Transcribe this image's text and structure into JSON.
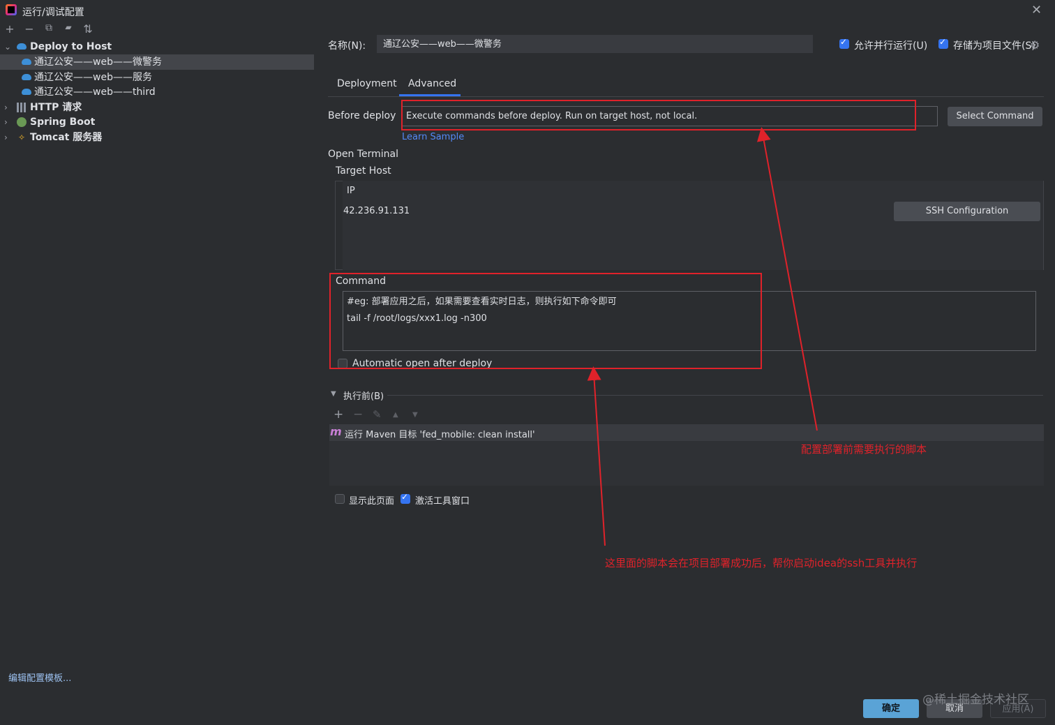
{
  "window": {
    "title": "运行/调试配置",
    "close": "✕"
  },
  "left_toolbar": {
    "add": "+",
    "remove": "−",
    "copy": "⧉",
    "folder": "▰",
    "sort": "⇅"
  },
  "tree": {
    "deploy_to_host": "Deploy to Host",
    "items": [
      "通辽公安——web——微警务",
      "通辽公安——web——服务",
      "通辽公安——web——third"
    ],
    "http": "HTTP 请求",
    "spring": "Spring Boot",
    "tomcat": "Tomcat 服务器"
  },
  "edit_templates": "编辑配置模板...",
  "help": "?",
  "name": {
    "label": "名称(N):",
    "value": "通辽公安——web——微警务"
  },
  "allow_parallel": "允许并行运行(U)",
  "store_project": "存储为项目文件(S)",
  "tabs": [
    "Deployment",
    "Advanced"
  ],
  "before_deploy": {
    "label": "Before deploy",
    "value": "Execute commands before deploy. Run on target host, not local.",
    "button": "Select Command",
    "link": "Learn Sample"
  },
  "open_terminal": "Open Terminal",
  "target_host": {
    "label": "Target Host",
    "ip_label": "IP",
    "ip": "42.236.91.131",
    "ssh_button": "SSH Configuration"
  },
  "command": {
    "label": "Command",
    "line1": "#eg: 部署应用之后，如果需要查看实时日志，则执行如下命令即可",
    "line2": "tail -f /root/logs/xxx1.log -n300",
    "auto_open": "Automatic open after deploy"
  },
  "before_launch": {
    "title": "执行前(B)",
    "toolbar": {
      "add": "+",
      "remove": "−",
      "edit": "✎",
      "up": "▲",
      "down": "▼"
    },
    "maven_icon": "m",
    "task": "运行 Maven 目标 'fed_mobile: clean install'"
  },
  "show_page": "显示此页面",
  "activate_tool": "激活工具窗口",
  "annotations": {
    "a1": "配置部署前需要执行的脚本",
    "a2": "这里面的脚本会在项目部署成功后，帮你启动idea的ssh工具并执行"
  },
  "buttons": {
    "ok": "确定",
    "cancel": "取消",
    "apply": "应用(A)"
  },
  "watermark": "@稀土掘金技术社区",
  "colors": {
    "accent": "#3574f0",
    "annotation_red": "#e0222a",
    "ok_button": "#5aa3d6",
    "link": "#548af7"
  }
}
